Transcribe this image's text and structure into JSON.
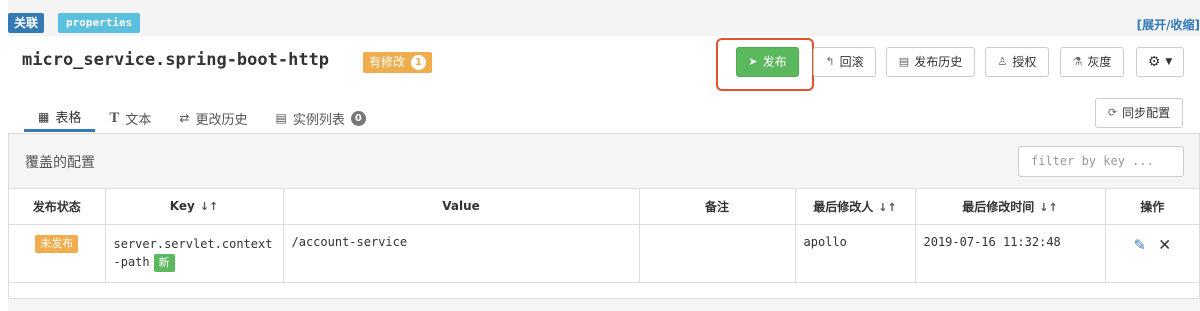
{
  "top": {
    "assoc_tag": "关联",
    "properties_tag": "properties",
    "expand_collapse": "[展开/收缩]"
  },
  "header": {
    "namespace": "micro_service.spring-boot-http",
    "modified_label": "有修改",
    "modified_count": "1",
    "buttons": {
      "publish": "发布",
      "rollback": "回滚",
      "history": "发布历史",
      "auth": "授权",
      "gray": "灰度"
    }
  },
  "tabs": [
    {
      "label": "表格",
      "icon": "table-icon"
    },
    {
      "label": "文本",
      "icon": "text-icon"
    },
    {
      "label": "更改历史",
      "icon": "exchange-icon"
    },
    {
      "label": "实例列表",
      "icon": "server-icon",
      "count": "0"
    }
  ],
  "sync_button": "同步配置",
  "section": {
    "title": "覆盖的配置",
    "filter_placeholder": "filter by key ..."
  },
  "table": {
    "columns": [
      "发布状态",
      "Key",
      "Value",
      "备注",
      "最后修改人",
      "最后修改时间",
      "操作"
    ],
    "rows": [
      {
        "status": "未发布",
        "key": "server.servlet.context-path",
        "new_badge": "新",
        "value": "/account-service",
        "comment": "",
        "modifier": "apollo",
        "modified_time": "2019-07-16 11:32:48"
      }
    ]
  },
  "colors": {
    "primary": "#337ab7",
    "success": "#5cb85c",
    "warning": "#f0ad4e",
    "info": "#5bc0de",
    "highlight": "#e0532b"
  }
}
